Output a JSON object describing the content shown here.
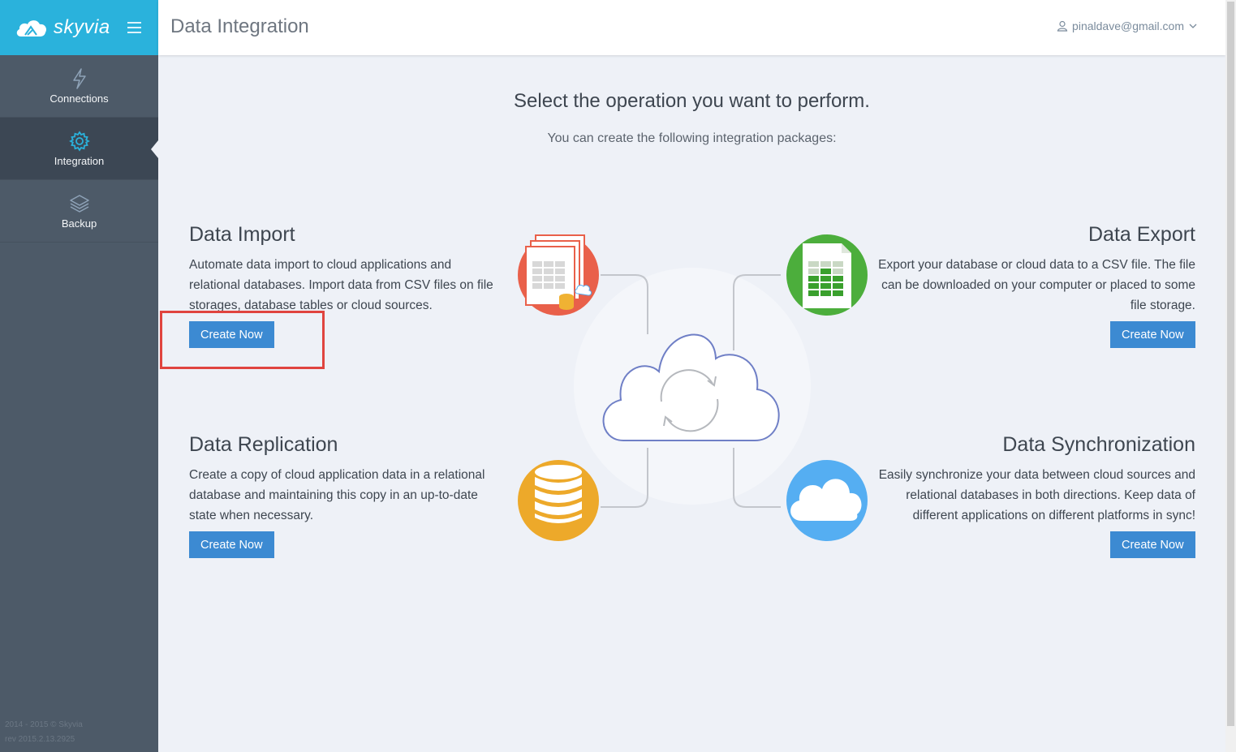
{
  "app": {
    "brand_name": "skyvia",
    "page_title": "Data Integration",
    "user_email": "pinaldave@gmail.com"
  },
  "sidebar": {
    "items": [
      {
        "label": "Connections",
        "icon": "lightning-icon",
        "active": false
      },
      {
        "label": "Integration",
        "icon": "gear-icon",
        "active": true
      },
      {
        "label": "Backup",
        "icon": "layers-icon",
        "active": false
      }
    ],
    "footer_copyright": "2014 - 2015 © Skyvia",
    "footer_revision": "rev 2015.2.13.2925"
  },
  "main": {
    "headline": "Select the operation you want to perform.",
    "subline": "You can create the following integration packages:",
    "packages": {
      "import": {
        "title": "Data Import",
        "description": "Automate data import to cloud applications and relational databases. Import data from CSV files on file storages, database tables or cloud sources.",
        "button": "Create Now",
        "icon": "import-documents-icon",
        "color": "#e9604a"
      },
      "export": {
        "title": "Data Export",
        "description": "Export your database or cloud data to a CSV file. The file can be downloaded on your computer or placed to some file storage.",
        "button": "Create Now",
        "icon": "spreadsheet-icon",
        "color": "#4cae3c"
      },
      "replication": {
        "title": "Data Replication",
        "description": "Create a copy of cloud application data in a relational database and maintaining this copy in an up-to-date state when necessary.",
        "button": "Create Now",
        "icon": "database-icon",
        "color": "#eda92a"
      },
      "sync": {
        "title": "Data Synchronization",
        "description": "Easily synchronize your data between cloud sources and relational databases in both directions. Keep data of different applications on different platforms in sync!",
        "button": "Create Now",
        "icon": "cloud-icon",
        "color": "#55aef2"
      }
    }
  },
  "colors": {
    "sidebar_bg": "#4d5a68",
    "brand_bg": "#2ab2dc",
    "button_bg": "#3c8ad2",
    "highlight": "#e0443f"
  }
}
